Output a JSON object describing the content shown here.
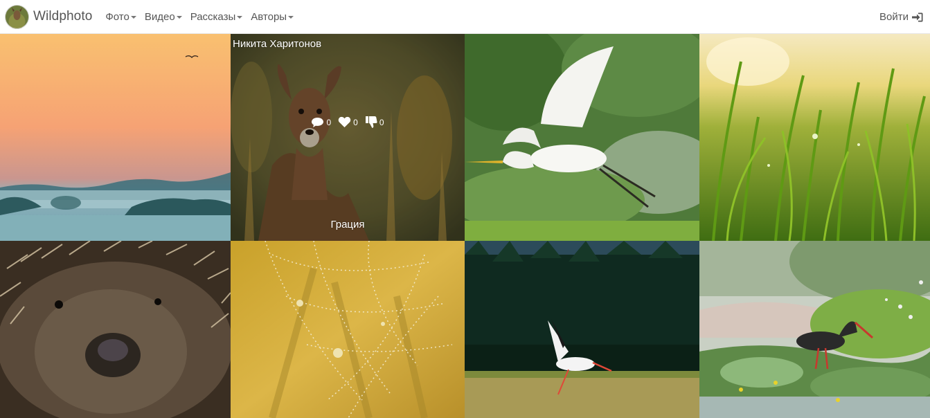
{
  "navbar": {
    "brand": "Wildphoto",
    "menu": [
      {
        "label": "Фото"
      },
      {
        "label": "Видео"
      },
      {
        "label": "Рассказы"
      },
      {
        "label": "Авторы"
      }
    ],
    "login": "Войти"
  },
  "gallery": {
    "featured": {
      "author": "Никита Харитонов",
      "title": "Грация",
      "comments": "0",
      "likes": "0",
      "dislikes": "0"
    },
    "photos": [
      {
        "subject": "foggy-sunrise"
      },
      {
        "subject": "roe-deer"
      },
      {
        "subject": "white-egret"
      },
      {
        "subject": "dewy-grass"
      },
      {
        "subject": "hedgehog"
      },
      {
        "subject": "dewy-cobweb"
      },
      {
        "subject": "white-stork"
      },
      {
        "subject": "black-stork"
      }
    ]
  },
  "colors": {
    "nav_text": "#555555",
    "overlay_text": "#ffffff"
  }
}
